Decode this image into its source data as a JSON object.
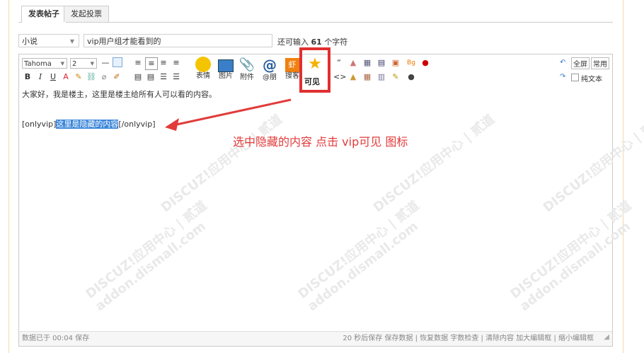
{
  "tabs": [
    {
      "label": "发表帖子",
      "active": true
    },
    {
      "label": "发起投票",
      "active": false
    }
  ],
  "category": {
    "value": "小说"
  },
  "subject": {
    "value": "vip用户组才能看到的"
  },
  "counter": {
    "prefix": "还可输入",
    "count": "61",
    "suffix": "个字符"
  },
  "toolbar": {
    "font": "Tahoma",
    "size": "2",
    "buttons": {
      "emoji": "表情",
      "image": "图片",
      "attach": "附件",
      "at": "@朋",
      "search": "搜客",
      "vip": "可见",
      "fullscreen": "全屏",
      "common": "常用",
      "plaintext": "纯文本"
    }
  },
  "content": {
    "line1": "大家好，我是楼主，这里是楼主给所有人可以看的内容。",
    "tag_open": "[onlyvip]",
    "hidden_text": "这里是隐藏的内容",
    "tag_close": "[/onlyvip]"
  },
  "annotation": "选中隐藏的内容 点击 vip可见 图标",
  "watermark": {
    "text": "DISCUZ!应用中心 | 贰道",
    "url": "addon.dismall.com"
  },
  "statusbar": {
    "saved": "数据已于 00:04 保存",
    "right_items": "20 秒后保存 保存数据 | 恢复数据    字数检查 | 清除内容    加大编辑框 | 缩小编辑框"
  },
  "colors": {
    "accent_red": "#e03030",
    "highlight_blue": "#3b86d9",
    "annotation_red": "#e23b3b"
  }
}
